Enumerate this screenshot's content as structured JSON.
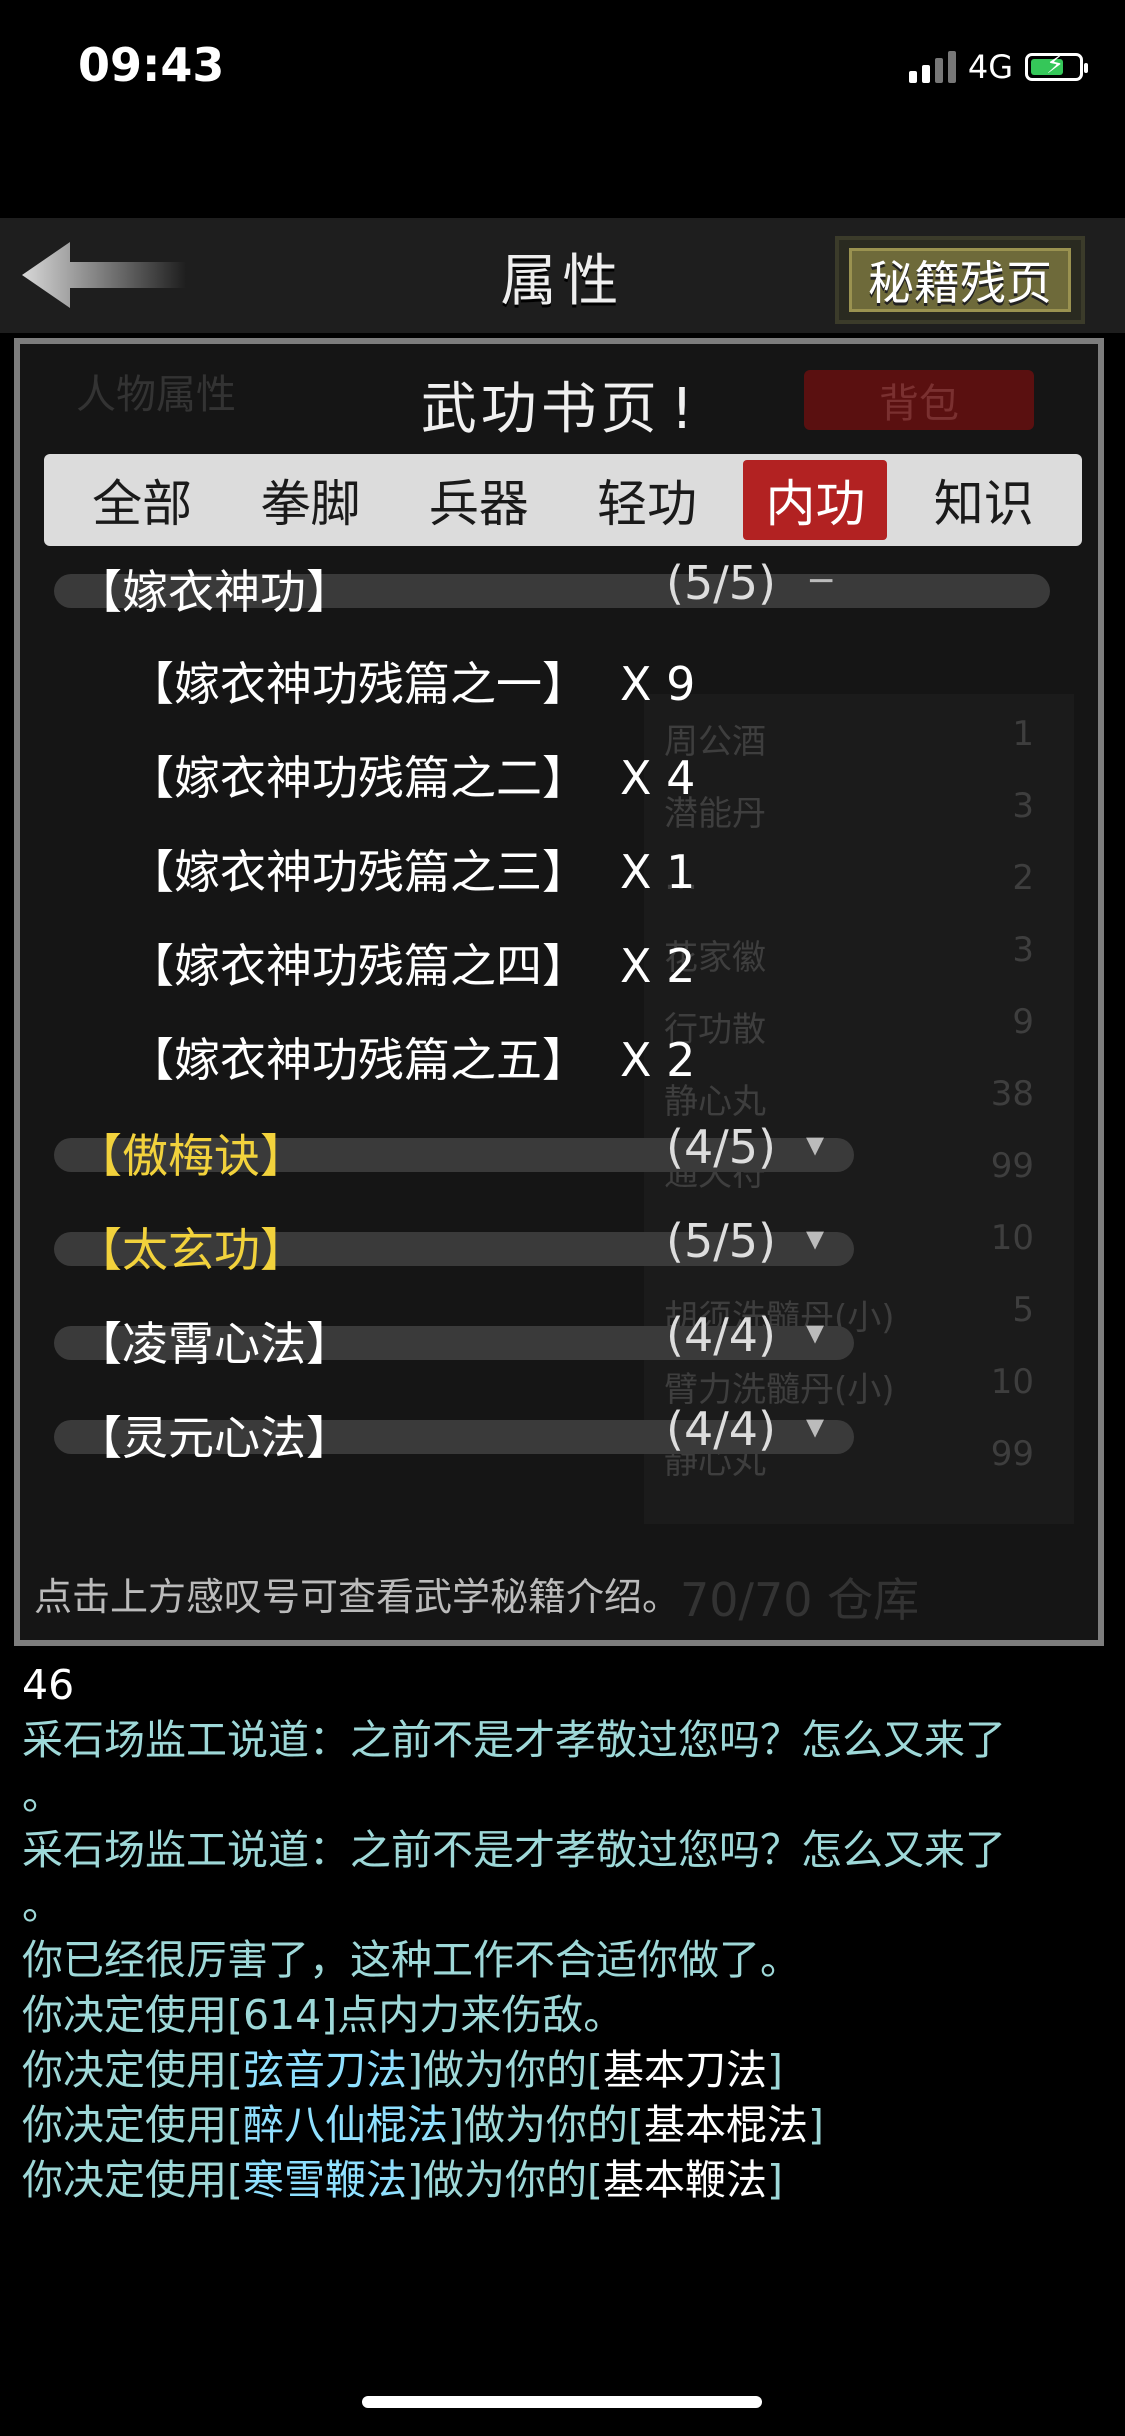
{
  "status_bar": {
    "time": "09:43",
    "network": "4G"
  },
  "header": {
    "title": "属性",
    "fragments_button": "秘籍残页"
  },
  "background_ui": {
    "character_attrs": "人物属性",
    "backpack": "背包",
    "storage": "70/70 仓库",
    "items": [
      {
        "name": "周公酒",
        "qty": "1"
      },
      {
        "name": "潜能丹",
        "qty": "3"
      },
      {
        "name": "…",
        "qty": "2"
      },
      {
        "name": "花家徽",
        "qty": "3"
      },
      {
        "name": "行功散",
        "qty": "9"
      },
      {
        "name": "静心丸",
        "qty": "38"
      },
      {
        "name": "通天符",
        "qty": "99"
      },
      {
        "name": "",
        "qty": "10"
      },
      {
        "name": "胡须洗髓丹(小)",
        "qty": "5"
      },
      {
        "name": "臂力洗髓丹(小)",
        "qty": "10"
      },
      {
        "name": "静心丸",
        "qty": "99"
      }
    ]
  },
  "panel": {
    "title": "武功书页",
    "info_icon": "exclamation-icon",
    "tabs": [
      {
        "label": "全部",
        "active": false
      },
      {
        "label": "拳脚",
        "active": false
      },
      {
        "label": "兵器",
        "active": false
      },
      {
        "label": "轻功",
        "active": false
      },
      {
        "label": "内功",
        "active": true
      },
      {
        "label": "知识",
        "active": false
      }
    ],
    "groups": [
      {
        "name": "【嫁衣神功】",
        "count": "(5/5)",
        "toggle": "−",
        "highlight": false,
        "expanded": true,
        "items": [
          {
            "name": "【嫁衣神功残篇之一】",
            "qty": "X 9"
          },
          {
            "name": "【嫁衣神功残篇之二】",
            "qty": "X 4"
          },
          {
            "name": "【嫁衣神功残篇之三】",
            "qty": "X 1"
          },
          {
            "name": "【嫁衣神功残篇之四】",
            "qty": "X 2"
          },
          {
            "name": "【嫁衣神功残篇之五】",
            "qty": "X 2"
          }
        ]
      },
      {
        "name": "【傲梅诀】",
        "count": "(4/5)",
        "toggle": "▾",
        "highlight": true,
        "expanded": false,
        "items": []
      },
      {
        "name": "【太玄功】",
        "count": "(5/5)",
        "toggle": "▾",
        "highlight": true,
        "expanded": false,
        "items": []
      },
      {
        "name": "【凌霄心法】",
        "count": "(4/4)",
        "toggle": "▾",
        "highlight": false,
        "expanded": false,
        "items": []
      },
      {
        "name": "【灵元心法】",
        "count": "(4/4)",
        "toggle": "▾",
        "highlight": false,
        "expanded": false,
        "items": []
      }
    ],
    "hint": "点击上方感叹号可查看武学秘籍介绍。"
  },
  "log": {
    "number": "46",
    "lines": [
      "采石场监工说道：之前不是才孝敬过您吗？怎么又来了",
      "。",
      "采石场监工说道：之前不是才孝敬过您吗？怎么又来了",
      "。",
      "你已经很厉害了，这种工作不合适你做了。",
      "你决定使用[614]点内力来伤敌。"
    ],
    "choices": [
      {
        "prefix": "你决定使用[",
        "skill": "弦音刀法",
        "mid": "]做为你的[",
        "base": "基本刀法",
        "suffix": "]"
      },
      {
        "prefix": "你决定使用[",
        "skill": "醉八仙棍法",
        "mid": "]做为你的[",
        "base": "基本棍法",
        "suffix": "]"
      },
      {
        "prefix": "你决定使用[",
        "skill": "寒雪鞭法",
        "mid": "]做为你的[",
        "base": "基本鞭法",
        "suffix": "]"
      }
    ]
  }
}
